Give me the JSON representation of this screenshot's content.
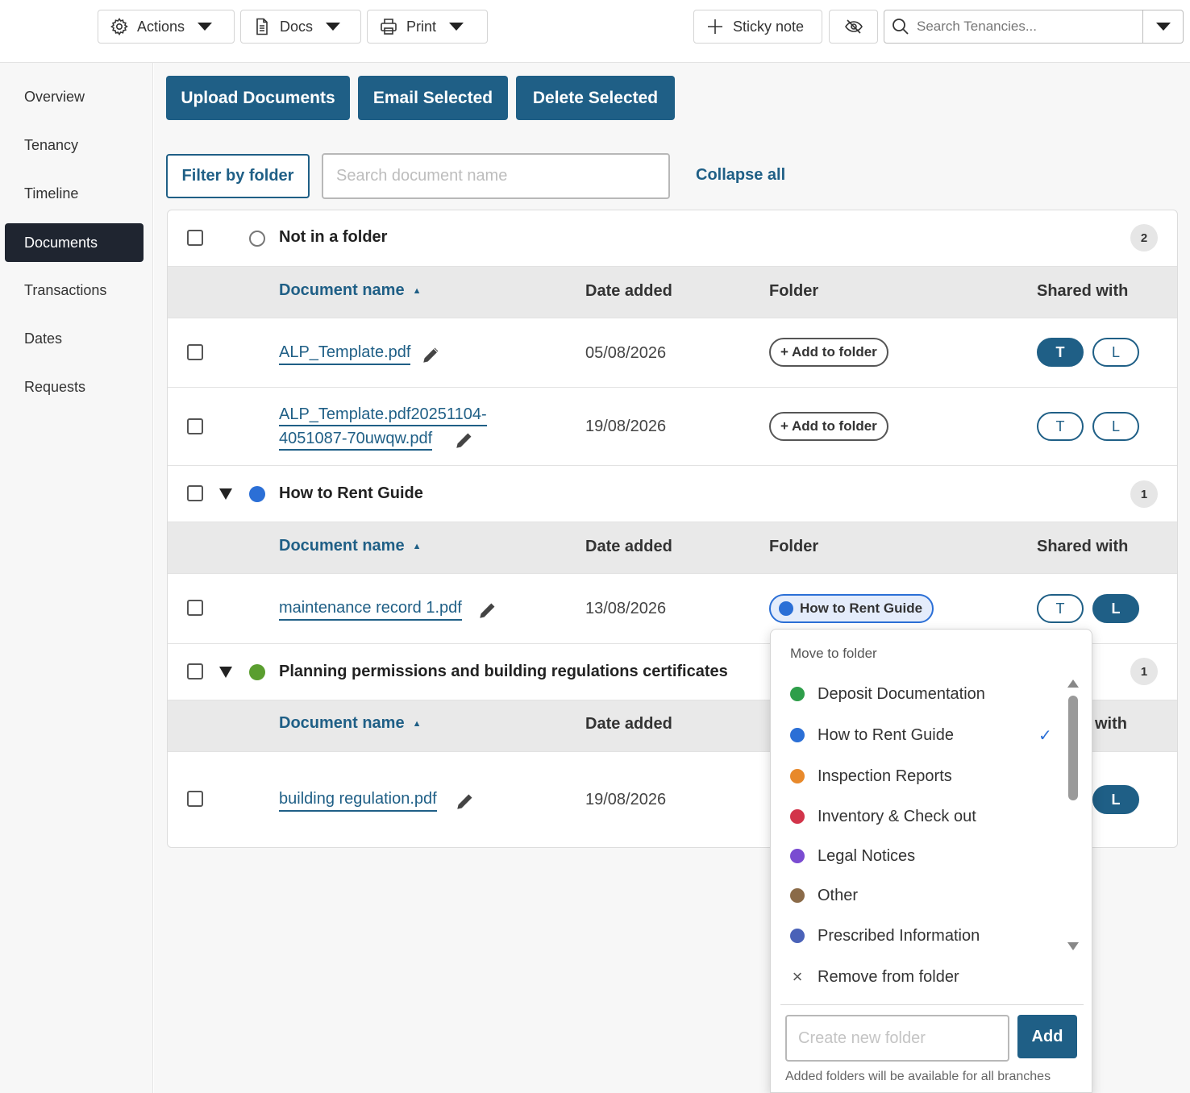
{
  "toolbar": {
    "actions_label": "Actions",
    "docs_label": "Docs",
    "print_label": "Print",
    "sticky_label": "Sticky note",
    "search_placeholder": "Search Tenancies..."
  },
  "sidebar": {
    "items": [
      {
        "label": "Overview"
      },
      {
        "label": "Tenancy"
      },
      {
        "label": "Timeline"
      },
      {
        "label": "Documents"
      },
      {
        "label": "Transactions"
      },
      {
        "label": "Dates"
      },
      {
        "label": "Requests"
      }
    ],
    "active": "Documents"
  },
  "actions": {
    "upload": "Upload Documents",
    "email": "Email Selected",
    "delete": "Delete Selected",
    "filter": "Filter by folder",
    "search_placeholder": "Search document name",
    "collapse": "Collapse all"
  },
  "columns": {
    "name": "Document name",
    "date": "Date added",
    "folder": "Folder",
    "shared": "Shared with",
    "shared_partial": "with"
  },
  "groups": [
    {
      "title": "Not in a folder",
      "count": "2",
      "color": "#ffffff",
      "docs": [
        {
          "name": "ALP_Template.pdf",
          "date": "05/08/2026",
          "folder_action": "+ Add to folder",
          "tenant": "T",
          "landlord": "L",
          "tenant_shared": true,
          "landlord_shared": false
        },
        {
          "name_line1": "ALP_Template.pdf20251104-",
          "name_line2": "4051087-70uwqw.pdf",
          "date": "19/08/2026",
          "folder_action": "+ Add to folder",
          "tenant": "T",
          "landlord": "L",
          "tenant_shared": false,
          "landlord_shared": false
        }
      ]
    },
    {
      "title": "How to Rent Guide",
      "count": "1",
      "color": "#2b6fd6",
      "docs": [
        {
          "name": "maintenance record 1.pdf",
          "date": "13/08/2026",
          "folder": "How to Rent Guide",
          "tenant": "T",
          "landlord": "L",
          "tenant_shared": false,
          "landlord_shared": true
        }
      ]
    },
    {
      "title": "Planning permissions and building regulations certificates",
      "count": "1",
      "color": "#5a9e2f",
      "docs": [
        {
          "name": "building regulation.pdf",
          "date": "19/08/2026",
          "landlord": "L",
          "landlord_shared": true
        }
      ]
    }
  ],
  "move_menu": {
    "title": "Move to folder",
    "options": [
      {
        "label": "Deposit Documentation",
        "color": "#2e9e4a"
      },
      {
        "label": "How to Rent Guide",
        "color": "#2b6fd6",
        "selected": true,
        "check": "✓"
      },
      {
        "label": "Inspection Reports",
        "color": "#e8892b"
      },
      {
        "label": "Inventory & Check out",
        "color": "#d2344a"
      },
      {
        "label": "Legal Notices",
        "color": "#7a4bd1"
      },
      {
        "label": "Other",
        "color": "#8a6a48"
      },
      {
        "label": "Prescribed Information",
        "color": "#4a62b8"
      }
    ],
    "remove": "Remove from folder",
    "new_placeholder": "Create new folder",
    "add_label": "Add",
    "note": "Added folders will be available for all branches"
  },
  "colors": {
    "primary": "#1f5f86",
    "nav_active": "#1f2530"
  }
}
